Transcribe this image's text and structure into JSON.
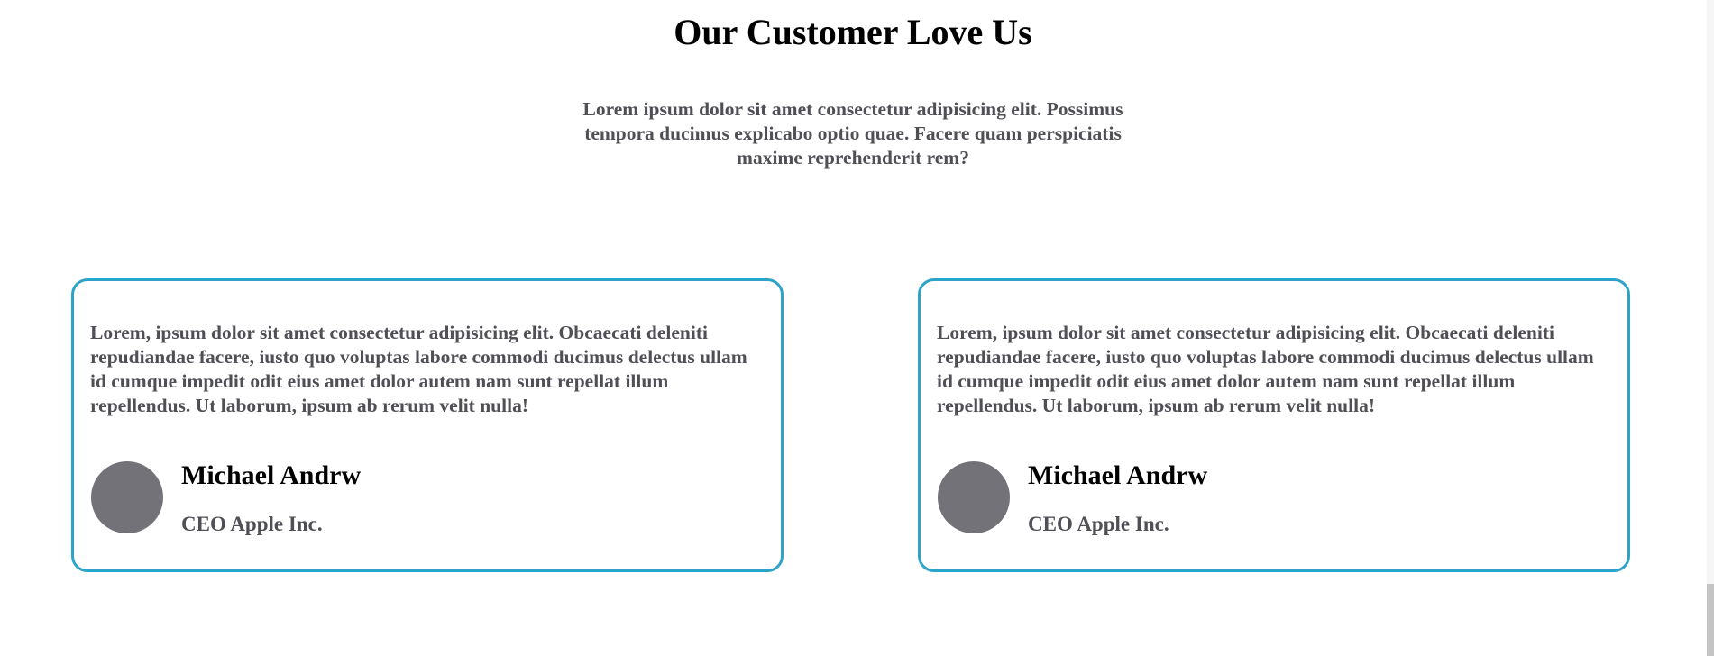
{
  "section": {
    "title": "Our Customer Love Us",
    "subtitle": "Lorem ipsum dolor sit amet consectetur adipisicing elit. Possimus tempora ducimus explicabo optio quae. Facere quam perspiciatis maxime reprehenderit rem?"
  },
  "testimonials": [
    {
      "text": "Lorem, ipsum dolor sit amet consectetur adipisicing elit. Obcaecati deleniti repudiandae facere, iusto quo voluptas labore commodi ducimus delectus ullam id cumque impedit odit eius amet dolor autem nam sunt repellat illum repellendus. Ut laborum, ipsum ab rerum velit nulla!",
      "name": "Michael Andrw",
      "role": "CEO Apple Inc."
    },
    {
      "text": "Lorem, ipsum dolor sit amet consectetur adipisicing elit. Obcaecati deleniti repudiandae facere, iusto quo voluptas labore commodi ducimus delectus ullam id cumque impedit odit eius amet dolor autem nam sunt repellat illum repellendus. Ut laborum, ipsum ab rerum velit nulla!",
      "name": "Michael Andrw",
      "role": "CEO Apple Inc."
    }
  ],
  "colors": {
    "card_border": "#2ea3c9",
    "avatar_placeholder": "#727278",
    "body_text": "#4f4f55",
    "heading_text": "#000000"
  }
}
